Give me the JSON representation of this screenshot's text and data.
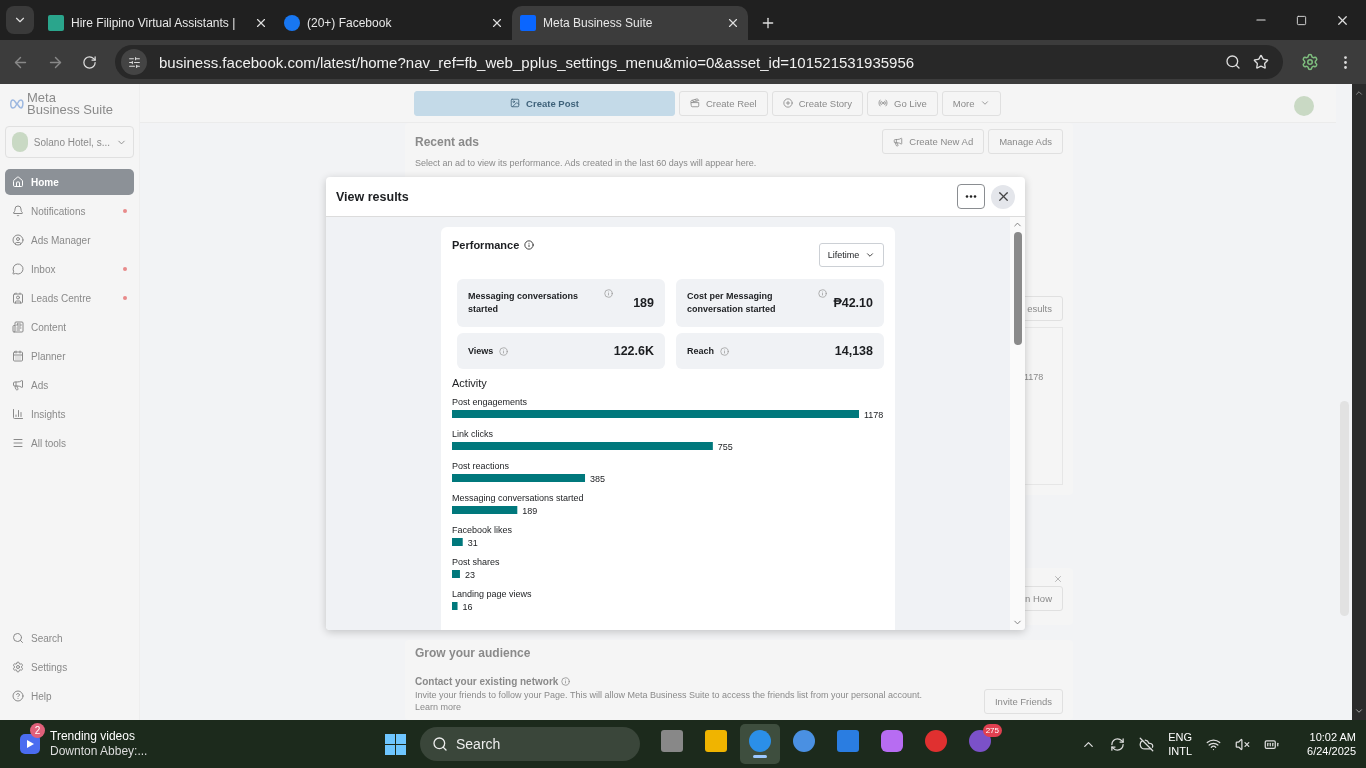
{
  "browser": {
    "tabs": [
      {
        "title": "Hire Filipino Virtual Assistants |",
        "selected": false
      },
      {
        "title": "(20+) Facebook",
        "selected": false
      },
      {
        "title": "Meta Business Suite",
        "selected": true
      }
    ],
    "url": "business.facebook.com/latest/home?nav_ref=fb_web_pplus_settings_menu&mio=0&asset_id=101521531935956"
  },
  "sidebar": {
    "logo": [
      "Meta",
      "Business Suite"
    ],
    "account": "Solano Hotel, s...",
    "items": [
      {
        "label": "Home",
        "selected": true,
        "dot": false
      },
      {
        "label": "Notifications",
        "selected": false,
        "dot": true
      },
      {
        "label": "Ads Manager",
        "selected": false,
        "dot": false
      },
      {
        "label": "Inbox",
        "selected": false,
        "dot": true
      },
      {
        "label": "Leads Centre",
        "selected": false,
        "dot": true
      },
      {
        "label": "Content",
        "selected": false,
        "dot": false
      },
      {
        "label": "Planner",
        "selected": false,
        "dot": false
      },
      {
        "label": "Ads",
        "selected": false,
        "dot": false
      },
      {
        "label": "Insights",
        "selected": false,
        "dot": false
      },
      {
        "label": "All tools",
        "selected": false,
        "dot": false
      }
    ],
    "bottom_items": [
      "Search",
      "Settings",
      "Help"
    ]
  },
  "toolbar": [
    {
      "label": "Create Post",
      "kind": "primary"
    },
    {
      "label": "Create Reel",
      "kind": "plain"
    },
    {
      "label": "Create Story",
      "kind": "plain"
    },
    {
      "label": "Go Live",
      "kind": "plain"
    },
    {
      "label": "More",
      "kind": "dropdown"
    }
  ],
  "recent_ads": {
    "title": "Recent ads",
    "buttons": [
      "Create New Ad",
      "Manage Ads"
    ],
    "description": "Select an ad to view its performance. Ads created in the last 60 days will appear here.",
    "results_button": "esults",
    "value": "1178"
  },
  "promo": {
    "button": "n How"
  },
  "grow": {
    "title": "Grow your audience",
    "subtitle": "Contact your existing network",
    "text": "Invite your friends to follow your Page. This will allow Meta Business Suite to access the friends list from your personal account.",
    "link": "Learn more",
    "button": "Invite Friends"
  },
  "modal": {
    "title": "View results",
    "performance": {
      "title": "Performance",
      "period": "Lifetime",
      "metrics": [
        {
          "label": "Messaging conversations started",
          "value": "189"
        },
        {
          "label": "Cost per Messaging conversation started",
          "value": "₱42.10"
        },
        {
          "label": "Views",
          "value": "122.6K"
        },
        {
          "label": "Reach",
          "value": "14,138"
        }
      ]
    },
    "activity": {
      "title": "Activity",
      "chart_data": {
        "type": "bar",
        "orientation": "horizontal",
        "data_labels": true,
        "categories": [
          "Post engagements",
          "Link clicks",
          "Post reactions",
          "Messaging conversations started",
          "Facebook likes",
          "Post shares",
          "Landing page views"
        ],
        "values": [
          1178,
          755,
          385,
          189,
          31,
          23,
          16
        ]
      }
    }
  },
  "taskbar": {
    "widget": {
      "badge": "2",
      "title": "Trending videos",
      "subtitle": "Downton Abbey:..."
    },
    "search": "Search",
    "apps": [
      {
        "selected": false
      },
      {
        "selected": false
      },
      {
        "selected": true
      },
      {
        "selected": false
      },
      {
        "selected": false
      },
      {
        "selected": false
      },
      {
        "selected": false
      },
      {
        "selected": false
      }
    ],
    "viber_badge": "275",
    "lang": "ENG",
    "lang_sub": "INTL",
    "time": "10:02 AM",
    "date": "6/24/2025"
  }
}
